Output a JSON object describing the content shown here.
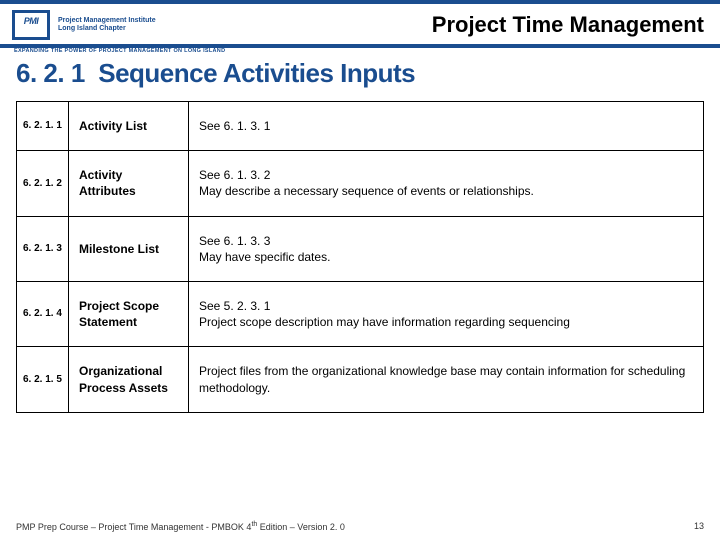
{
  "header": {
    "logo_org1": "Project Management Institute",
    "logo_org2": "Long Island Chapter",
    "tagline": "EXPANDING THE POWER OF PROJECT MANAGEMENT ON LONG ISLAND",
    "title": "Project Time Management"
  },
  "section": {
    "number": "6. 2. 1",
    "title": "Sequence Activities Inputs"
  },
  "rows": [
    {
      "num": "6. 2. 1. 1",
      "label": "Activity List",
      "desc": "See 6. 1. 3. 1"
    },
    {
      "num": "6. 2. 1. 2",
      "label": "Activity Attributes",
      "desc": "See 6. 1. 3. 2\nMay describe a necessary sequence of events or relationships."
    },
    {
      "num": "6. 2. 1. 3",
      "label": "Milestone List",
      "desc": "See 6. 1. 3. 3\nMay have specific dates."
    },
    {
      "num": "6. 2. 1. 4",
      "label": "Project Scope Statement",
      "desc": "See 5. 2. 3. 1\nProject scope description may have information regarding sequencing"
    },
    {
      "num": "6. 2. 1. 5",
      "label": "Organizational Process Assets",
      "desc": "Project files from the organizational knowledge base may contain information for scheduling methodology."
    }
  ],
  "footer": {
    "left_a": "PMP Prep Course – Project Time Management - PMBOK 4",
    "left_b": " Edition – Version 2. 0",
    "page": "13"
  }
}
